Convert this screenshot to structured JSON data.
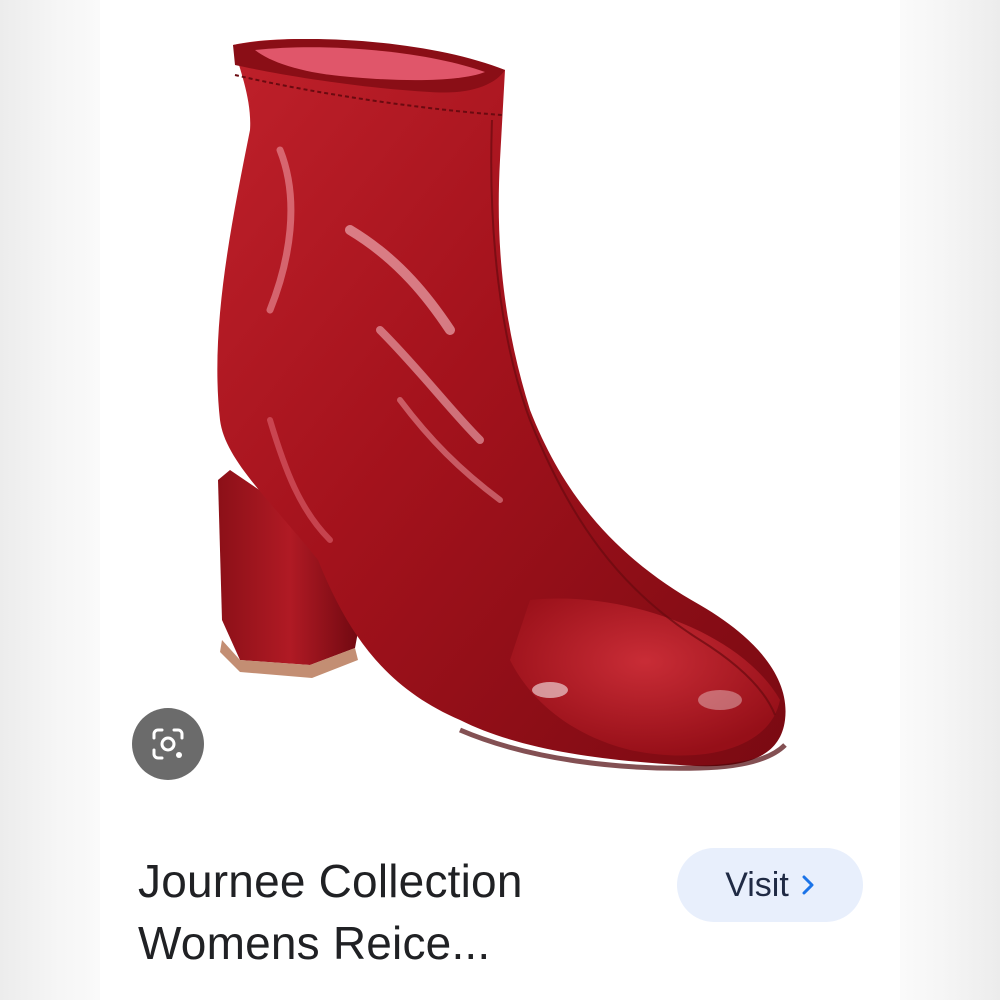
{
  "product": {
    "title_line1": "Journee Collection",
    "title_line2": "Womens Reice...",
    "image_subject": "red patent leather block-heel ankle boot"
  },
  "actions": {
    "visit_label": "Visit",
    "visit_icon": "chevron-right-icon",
    "lens_icon": "google-lens-icon"
  },
  "colors": {
    "boot_red": "#a3121c",
    "visit_bg": "#e8effc",
    "visit_chevron": "#1a73e8",
    "lens_bg": "#6b6b6b"
  }
}
